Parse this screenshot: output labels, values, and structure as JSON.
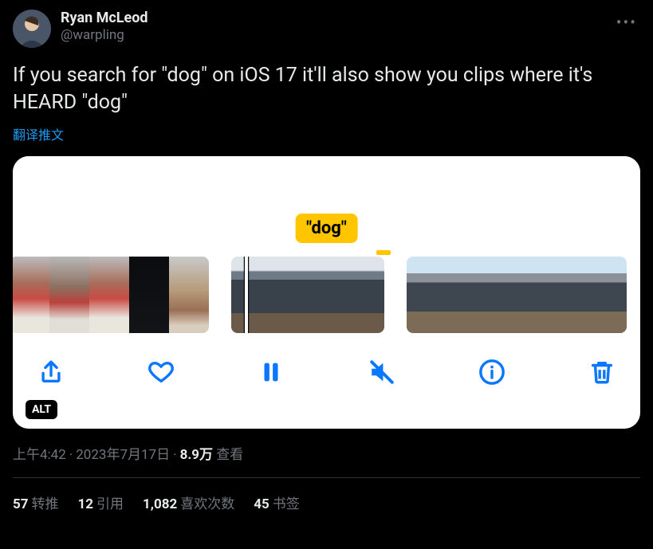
{
  "author": {
    "display_name": "Ryan McLeod",
    "handle": "@warpling"
  },
  "body_text": "If you search for \"dog\" on iOS 17 it'll also show you clips where it's HEARD \"dog\"",
  "translate_label": "翻译推文",
  "media": {
    "search_term": "\"dog\"",
    "alt_badge": "ALT",
    "toolbar_icons": {
      "share": "share-icon",
      "like": "heart-icon",
      "pause": "pause-icon",
      "mute": "mute-icon",
      "info": "info-icon",
      "trash": "trash-icon"
    }
  },
  "meta": {
    "time": "上午4:42",
    "date": "2023年7月17日",
    "views_number": "8.9万",
    "views_label": "查看"
  },
  "stats": {
    "retweets": {
      "count": "57",
      "label": "转推"
    },
    "quotes": {
      "count": "12",
      "label": "引用"
    },
    "likes": {
      "count": "1,082",
      "label": "喜欢次数"
    },
    "bookmarks": {
      "count": "45",
      "label": "书签"
    }
  }
}
